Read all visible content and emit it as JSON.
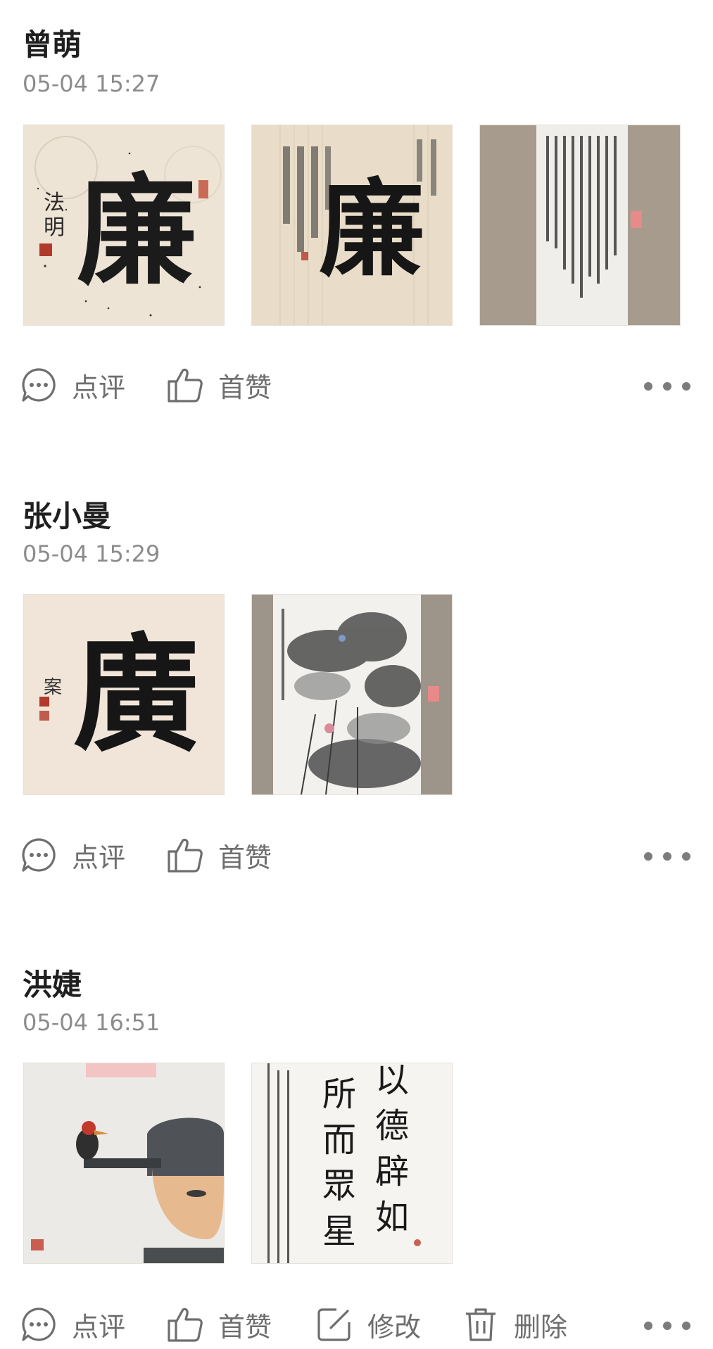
{
  "posts": [
    {
      "author": "曾萌",
      "time": "05-04 15:27",
      "photos": [
        "calligraphy-lian-1",
        "calligraphy-lian-2",
        "hanging-scroll-text"
      ],
      "actions": {
        "comment": "点评",
        "like": "首赞"
      }
    },
    {
      "author": "张小曼",
      "time": "05-04 15:29",
      "photos": [
        "calligraphy-lian-3",
        "ink-painting-lotus"
      ],
      "actions": {
        "comment": "点评",
        "like": "首赞"
      }
    },
    {
      "author": "洪婕",
      "time": "05-04 16:51",
      "photos": [
        "cartoon-woodpecker-official",
        "calligraphy-couplet"
      ],
      "actions": {
        "comment": "点评",
        "like": "首赞",
        "edit": "修改",
        "delete": "删除"
      }
    }
  ],
  "photo_text": {
    "lian": "廉",
    "lian_alt": "廣",
    "couplet_col1": "所而眾星拱",
    "couplet_col2": "以德辟如北"
  },
  "colors": {
    "icon": "#6e6e6e",
    "paper": "#efe6d8",
    "ink": "#1a1a1a",
    "wall": "#a69b8d"
  }
}
